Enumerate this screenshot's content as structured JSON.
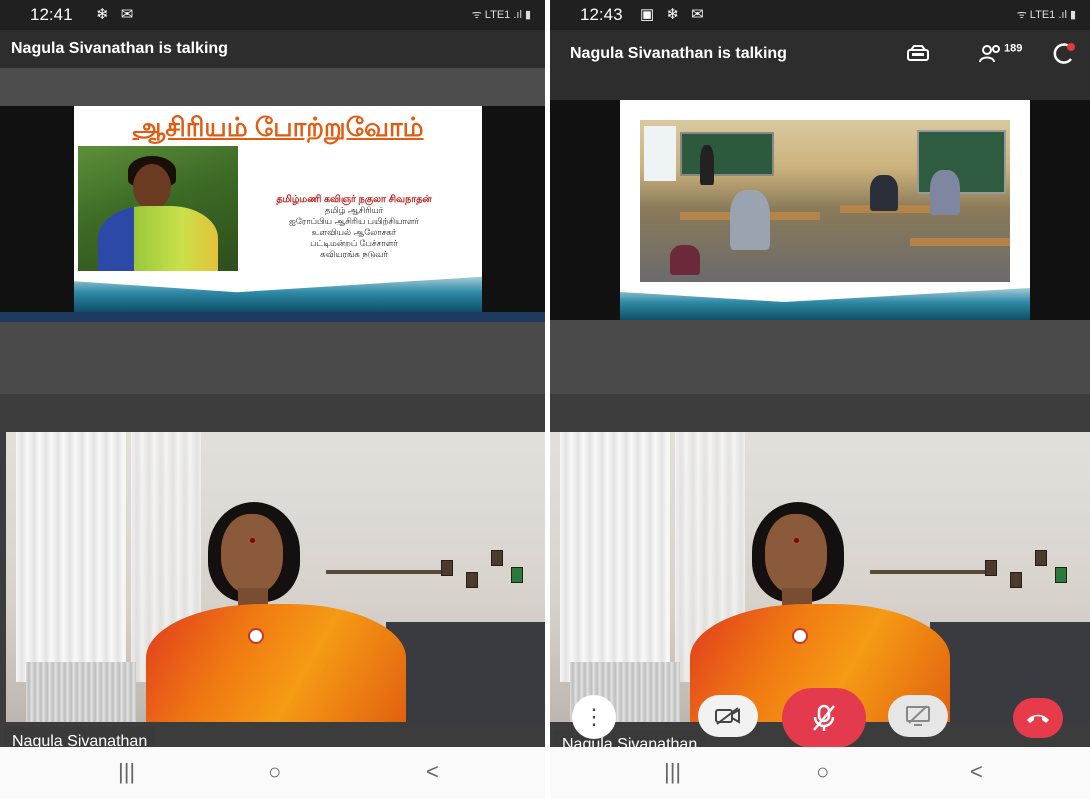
{
  "left": {
    "status": {
      "time": "12:41",
      "icons": [
        "snowflake-icon",
        "message-icon"
      ],
      "right": "ᯤ LTE1 .ıl ▮"
    },
    "header": {
      "title": "Nagula Sivanathan is talking"
    },
    "slide": {
      "title": "ஆசிரியம் போற்றுவோம்",
      "lines": [
        "தமிழ்மணி கவிஞர் நகுலா சிவநாதன்",
        "தமிழ் ஆசிரியர்",
        "ஐரோப்பிய ஆசிரிய பயிற்சியாளர்",
        "உளவியல் ஆலோசகர்",
        "பட்டிமன்றப் பேச்சாளர்",
        "கவியரங்க நடுவர்"
      ]
    },
    "video": {
      "name": "Nagula Sivanathan"
    },
    "navbar": {
      "recent": "|||",
      "home": "○",
      "back": "<"
    }
  },
  "right": {
    "status": {
      "time": "12:43",
      "icons": [
        "image-icon",
        "snowflake-icon",
        "message-icon"
      ],
      "right": "ᯤ LTE1 .ıl ▮"
    },
    "header": {
      "title": "Nagula Sivanathan is talking",
      "participants_count": "189"
    },
    "video": {
      "name": "Nagula Sivanathan"
    },
    "controls": [
      "more-options",
      "camera-off",
      "mic-off",
      "screen-share-off",
      "end-call"
    ],
    "navbar": {
      "recent": "|||",
      "home": "○",
      "back": "<"
    }
  },
  "colors": {
    "mic_red": "#e33a4d",
    "end_call_red": "#e73a4a",
    "slide_title_orange": "#e15b10"
  }
}
